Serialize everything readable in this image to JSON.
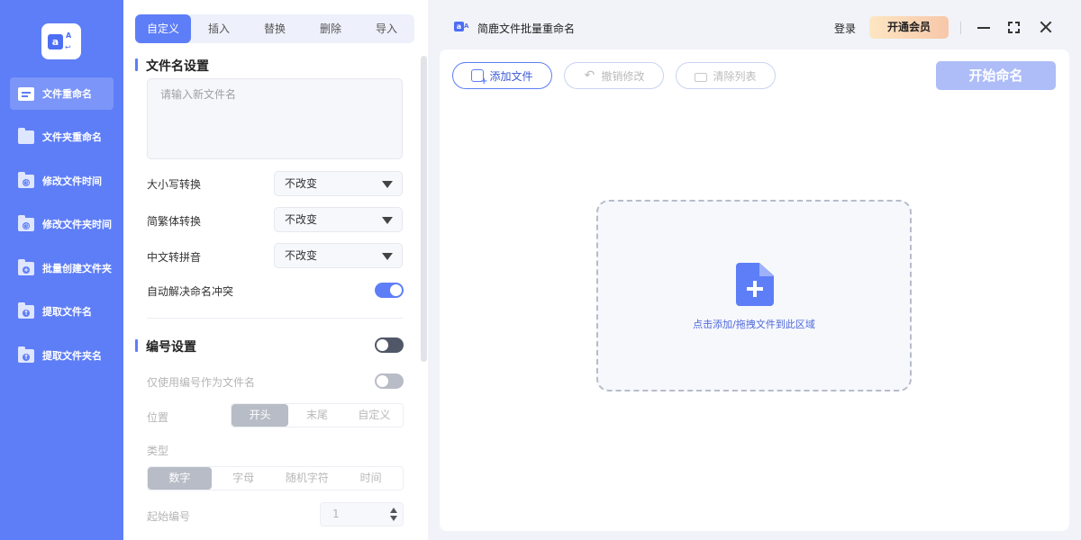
{
  "nav": {
    "items": [
      {
        "label": "文件重命名",
        "icon": "file-icon",
        "active": true
      },
      {
        "label": "文件夹重命名",
        "icon": "folder-icon",
        "active": false
      },
      {
        "label": "修改文件时间",
        "icon": "folder-clock-icon",
        "active": false
      },
      {
        "label": "修改文件夹时间",
        "icon": "folder-clock-icon",
        "active": false
      },
      {
        "label": "批量创建文件夹",
        "icon": "folder-plus-icon",
        "active": false
      },
      {
        "label": "提取文件名",
        "icon": "folder-upload-icon",
        "active": false
      },
      {
        "label": "提取文件夹名",
        "icon": "folder-upload-icon",
        "active": false
      }
    ]
  },
  "panel": {
    "tabs": [
      "自定义",
      "插入",
      "替换",
      "删除",
      "导入"
    ],
    "active_tab": 0,
    "filename_section": {
      "title": "文件名设置",
      "input_placeholder": "请输入新文件名",
      "case_label": "大小写转换",
      "case_value": "不改变",
      "trad_label": "简繁体转换",
      "trad_value": "不改变",
      "pinyin_label": "中文转拼音",
      "pinyin_value": "不改变",
      "conflict_label": "自动解决命名冲突",
      "conflict_on": true
    },
    "number_section": {
      "title": "编号设置",
      "enabled": false,
      "only_number_label": "仅使用编号作为文件名",
      "position_label": "位置",
      "position_options": [
        "开头",
        "末尾",
        "自定义"
      ],
      "position_selected": 0,
      "type_label": "类型",
      "type_options": [
        "数字",
        "字母",
        "随机字符",
        "时间"
      ],
      "type_selected": 0,
      "start_label": "起始编号",
      "start_value": "1"
    }
  },
  "main": {
    "app_title": "简鹿文件批量重命名",
    "login": "登录",
    "vip": "开通会员",
    "toolbar": {
      "add_files": "添加文件",
      "undo": "撤销修改",
      "clear": "清除列表",
      "start": "开始命名"
    },
    "drop_text": "点击添加/拖拽文件到此区域"
  },
  "colors": {
    "accent": "#5e7ef7",
    "nav_bg": "#5e7ef7",
    "vip_gradient": [
      "#fde6c3",
      "#f7c7a9"
    ]
  }
}
